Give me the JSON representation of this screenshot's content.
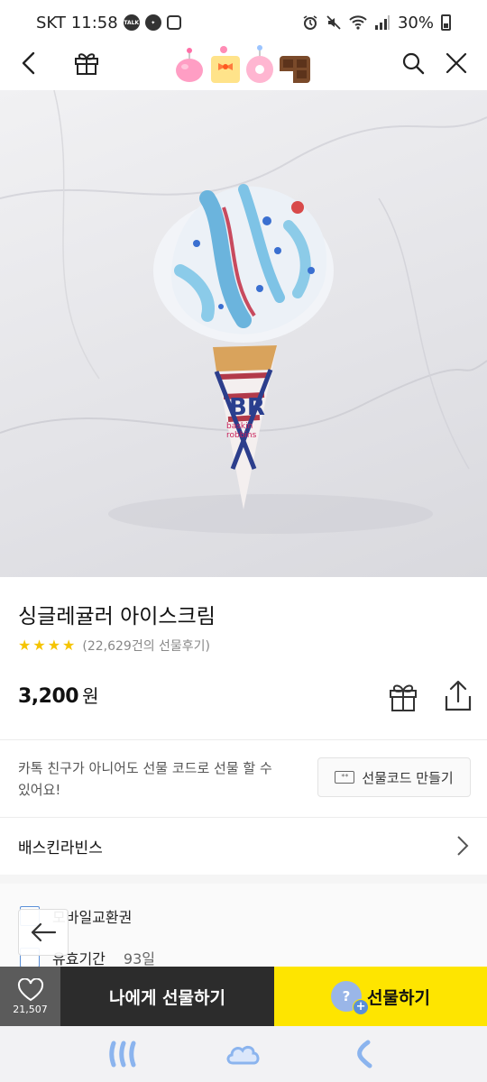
{
  "status_bar": {
    "carrier": "SKT",
    "time": "11:58",
    "talk_badge": "TALK",
    "battery": "30%"
  },
  "product": {
    "title": "싱글레귤러 아이스크림",
    "rating_stars": 4,
    "review_count": "(22,629건의 선물후기)",
    "price": "3,200",
    "price_unit": "원"
  },
  "gift_code": {
    "description": "카톡 친구가 아니어도 선물 코드로 선물 할 수 있어요!",
    "button_label": "선물코드 만들기"
  },
  "brand": {
    "name": "배스킨라빈스"
  },
  "info": {
    "type_label": "모바일교환권",
    "validity_label": "유효기간",
    "validity_value": "93일"
  },
  "bottom_bar": {
    "wish_count": "21,507",
    "self_gift_label": "나에게 선물하기",
    "gift_label": "선물하기",
    "gift_bubble": "?"
  },
  "colors": {
    "accent_yellow": "#fee500",
    "dark_button": "#2c2c2c",
    "star": "#f5c400",
    "brand_blue": "#5a8fd8"
  }
}
